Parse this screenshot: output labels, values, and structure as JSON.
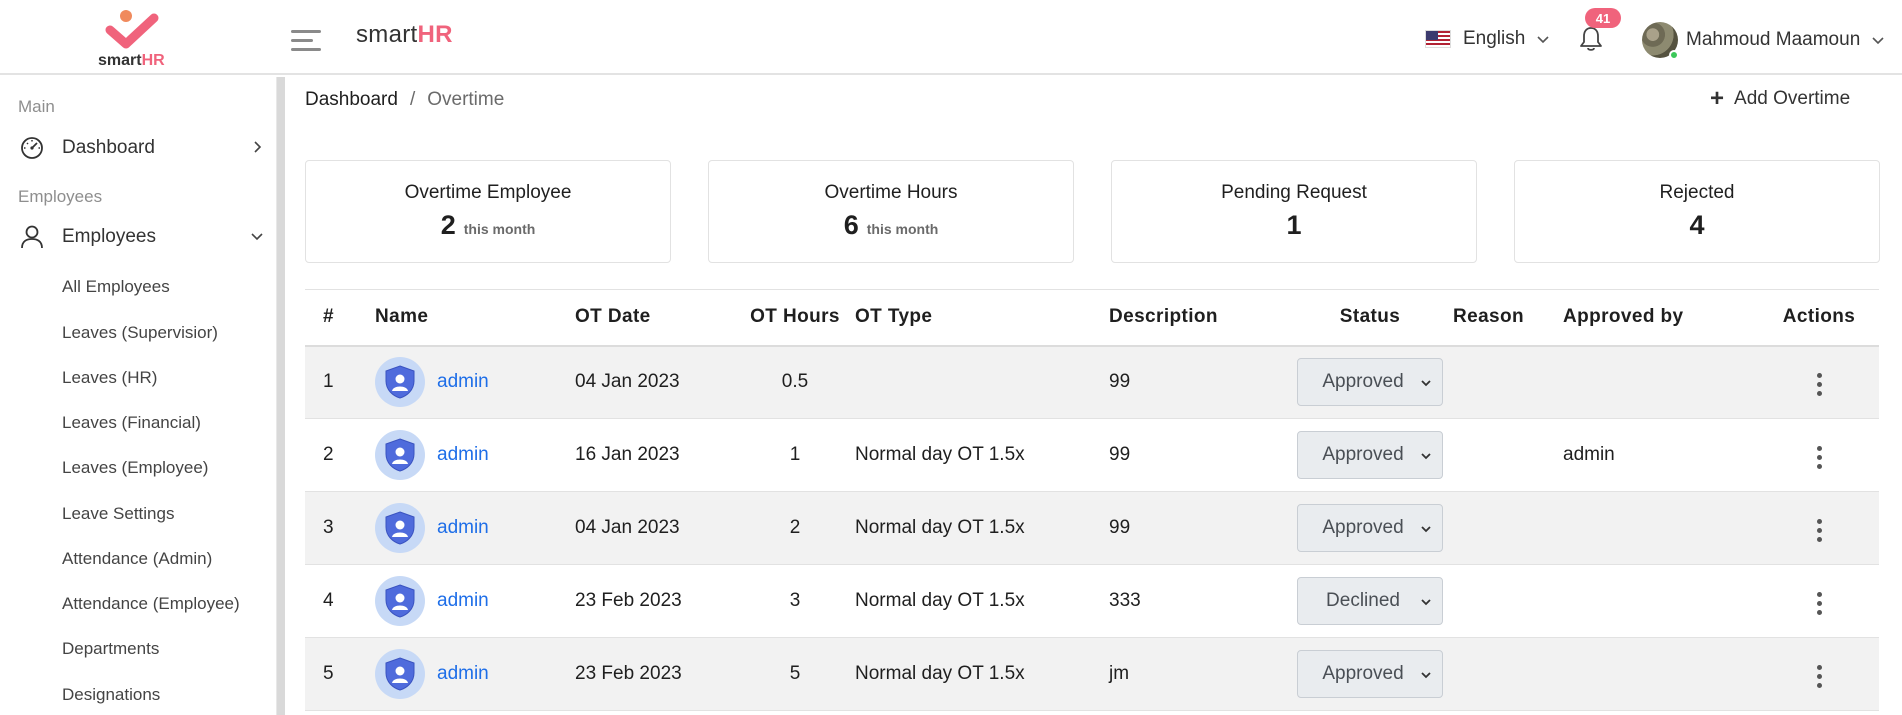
{
  "header": {
    "logo_text_1": "smart",
    "logo_text_2": "HR",
    "brand_1": "smart",
    "brand_2": "HR",
    "language": "English",
    "notifications_count": "41",
    "user_name": "Mahmoud Maamoun",
    "icons": [
      "menu-icon",
      "us-flag-icon",
      "chevron-down-icon",
      "bell-icon",
      "avatar"
    ]
  },
  "sidebar": {
    "section_main": "Main",
    "dashboard": "Dashboard",
    "section_employees": "Employees",
    "employees": "Employees",
    "sub_items": [
      "All Employees",
      "Leaves (Supervisior)",
      "Leaves (HR)",
      "Leaves (Financial)",
      "Leaves (Employee)",
      "Leave Settings",
      "Attendance (Admin)",
      "Attendance (Employee)",
      "Departments",
      "Designations"
    ]
  },
  "breadcrumb": {
    "home": "Dashboard",
    "separator": "/",
    "current": "Overtime"
  },
  "actions": {
    "add_overtime": "Add Overtime"
  },
  "stats": [
    {
      "title": "Overtime Employee",
      "value": "2",
      "sub": "this month"
    },
    {
      "title": "Overtime Hours",
      "value": "6",
      "sub": "this month"
    },
    {
      "title": "Pending Request",
      "value": "1",
      "sub": ""
    },
    {
      "title": "Rejected",
      "value": "4",
      "sub": ""
    }
  ],
  "table": {
    "headers": [
      "#",
      "Name",
      "OT Date",
      "OT Hours",
      "OT Type",
      "Description",
      "Status",
      "Reason",
      "Approved by",
      "Actions"
    ],
    "rows": [
      {
        "num": "1",
        "name": "admin",
        "date": "04 Jan 2023",
        "hours": "0.5",
        "type": "",
        "desc": "99",
        "status": "Approved",
        "reason": "",
        "approved_by": ""
      },
      {
        "num": "2",
        "name": "admin",
        "date": "16 Jan 2023",
        "hours": "1",
        "type": "Normal day OT 1.5x",
        "desc": "99",
        "status": "Approved",
        "reason": "",
        "approved_by": "admin"
      },
      {
        "num": "3",
        "name": "admin",
        "date": "04 Jan 2023",
        "hours": "2",
        "type": "Normal day OT 1.5x",
        "desc": "99",
        "status": "Approved",
        "reason": "",
        "approved_by": ""
      },
      {
        "num": "4",
        "name": "admin",
        "date": "23 Feb 2023",
        "hours": "3",
        "type": "Normal day OT 1.5x",
        "desc": "333",
        "status": "Declined",
        "reason": "",
        "approved_by": ""
      },
      {
        "num": "5",
        "name": "admin",
        "date": "23 Feb 2023",
        "hours": "5",
        "type": "Normal day OT 1.5x",
        "desc": "jm",
        "status": "Approved",
        "reason": "",
        "approved_by": ""
      }
    ]
  },
  "colors": {
    "brand_accent": "#f0637c",
    "link": "#1e6ee8",
    "row_alt": "#f2f2f2"
  }
}
